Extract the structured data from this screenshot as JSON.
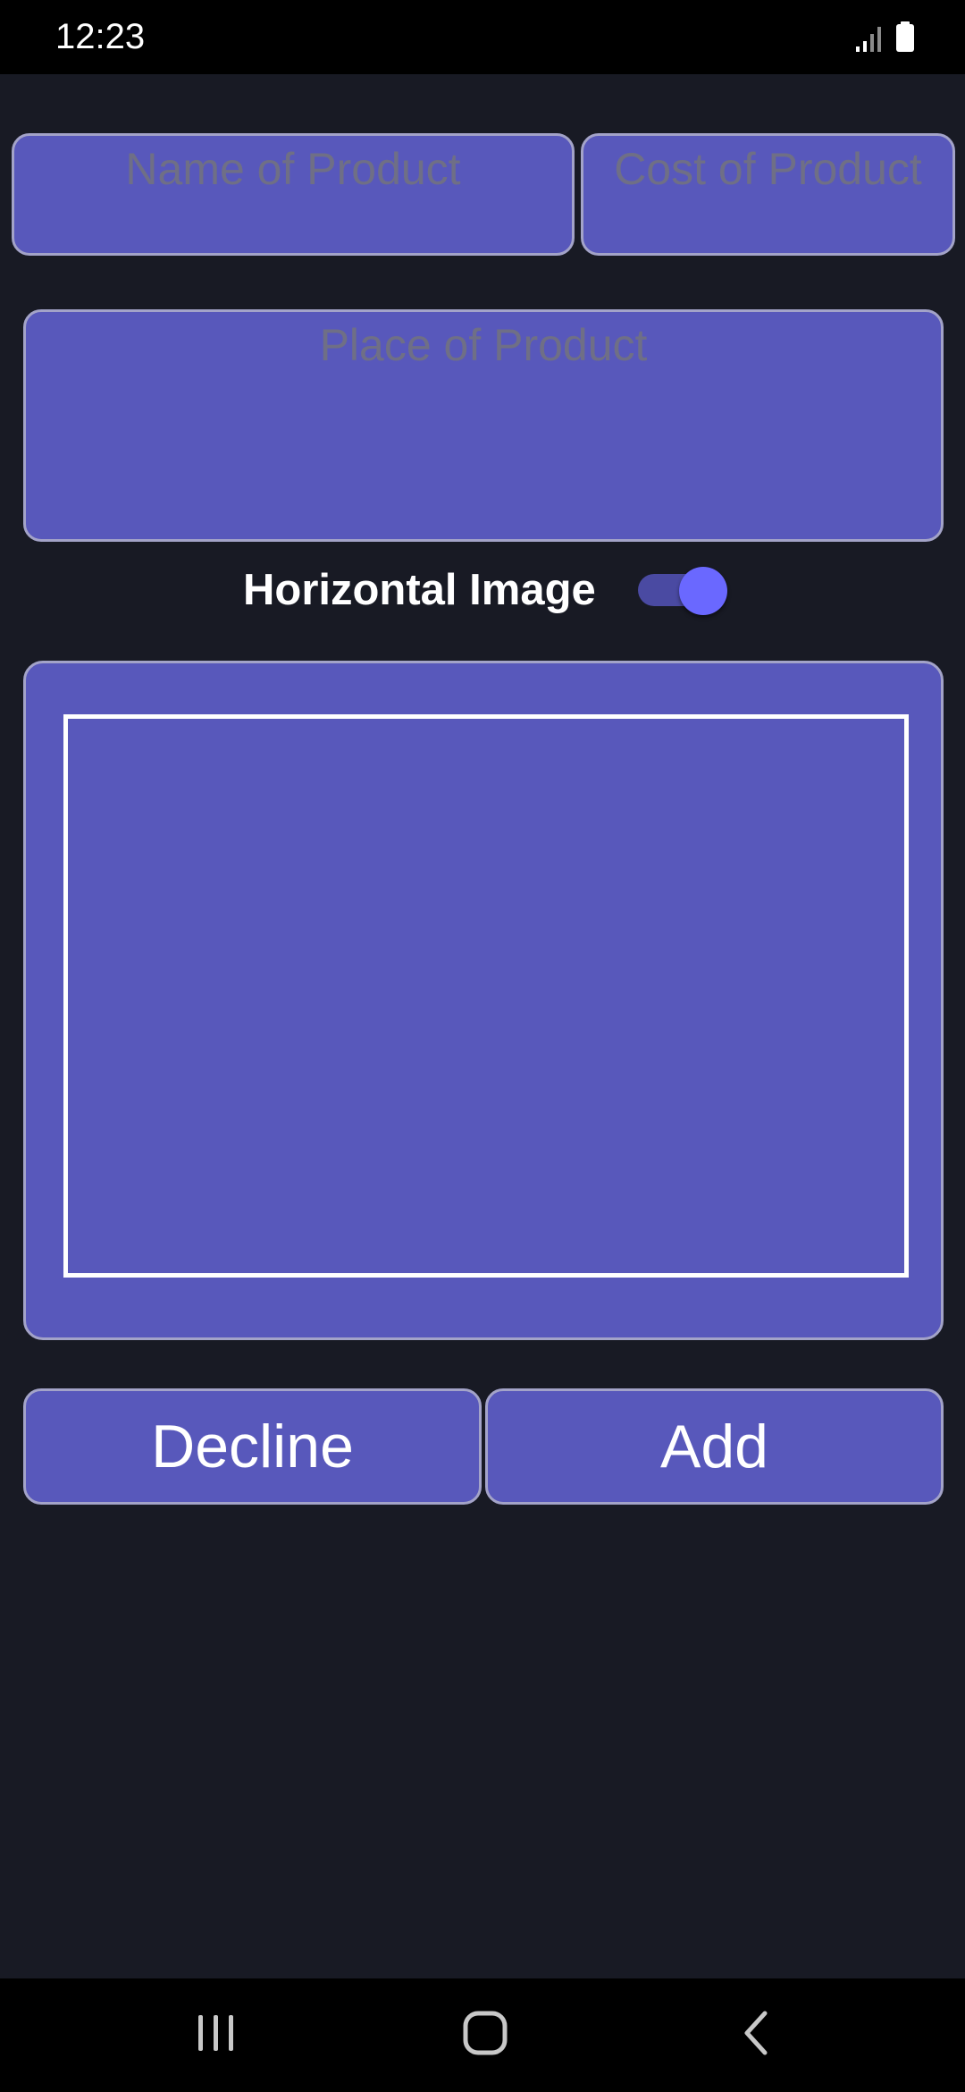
{
  "status_bar": {
    "time": "12:23",
    "signal_icon": "signal-icon",
    "battery_icon": "battery-icon"
  },
  "form": {
    "name_placeholder": "Name of Product",
    "cost_placeholder": "Cost of Product",
    "place_placeholder": "Place of Product"
  },
  "toggle": {
    "label": "Horizontal Image",
    "on": true
  },
  "image_panel": {
    "frame_icon": "image-frame"
  },
  "buttons": {
    "decline_label": "Decline",
    "add_label": "Add"
  },
  "nav_bar": {
    "recents_icon": "recents-icon",
    "home_icon": "home-icon",
    "back_icon": "back-icon"
  },
  "colors": {
    "background": "#181a24",
    "panel": "#5858bb",
    "border": "#a3a3c8",
    "placeholder_text": "#6f6f86",
    "toggle_thumb": "#6a68ff",
    "toggle_track": "#4a4aa2"
  }
}
